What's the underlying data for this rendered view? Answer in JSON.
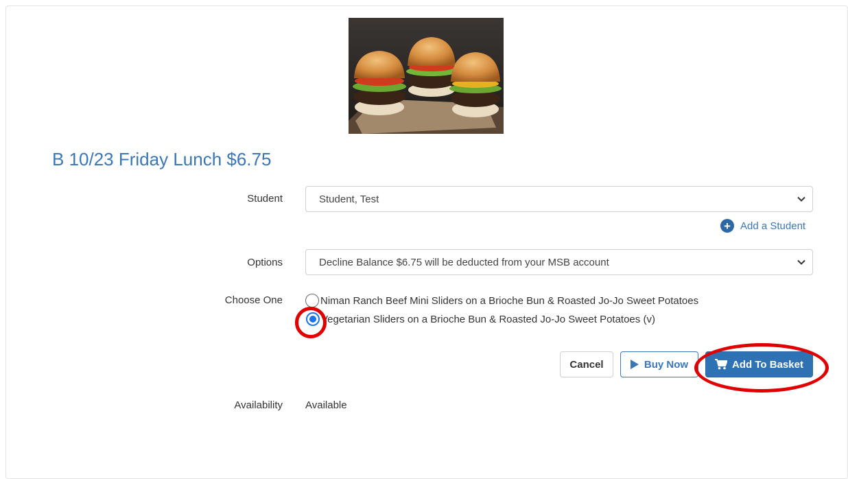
{
  "product": {
    "title": "B 10/23 Friday Lunch $6.75",
    "image_alt": "Beef mini sliders"
  },
  "form": {
    "student_label": "Student",
    "student_value": "Student, Test",
    "add_student_label": "Add a Student",
    "options_label": "Options",
    "options_value": "Decline Balance $6.75 will be deducted from your MSB account",
    "choose_label": "Choose One",
    "choices": [
      {
        "label": "Niman Ranch Beef Mini Sliders on a Brioche Bun & Roasted Jo-Jo Sweet Potatoes",
        "selected": false
      },
      {
        "label": "Vegetarian Sliders on a Brioche Bun & Roasted Jo-Jo Sweet Potatoes (v)",
        "selected": true
      }
    ],
    "availability_label": "Availability",
    "availability_value": "Available"
  },
  "buttons": {
    "cancel": "Cancel",
    "buy_now": "Buy Now",
    "add_to_basket": "Add To Basket"
  },
  "colors": {
    "title": "#3a76b8",
    "primary": "#2e72b4",
    "annotation": "#e00000",
    "radio_checked": "#1a73e8"
  }
}
